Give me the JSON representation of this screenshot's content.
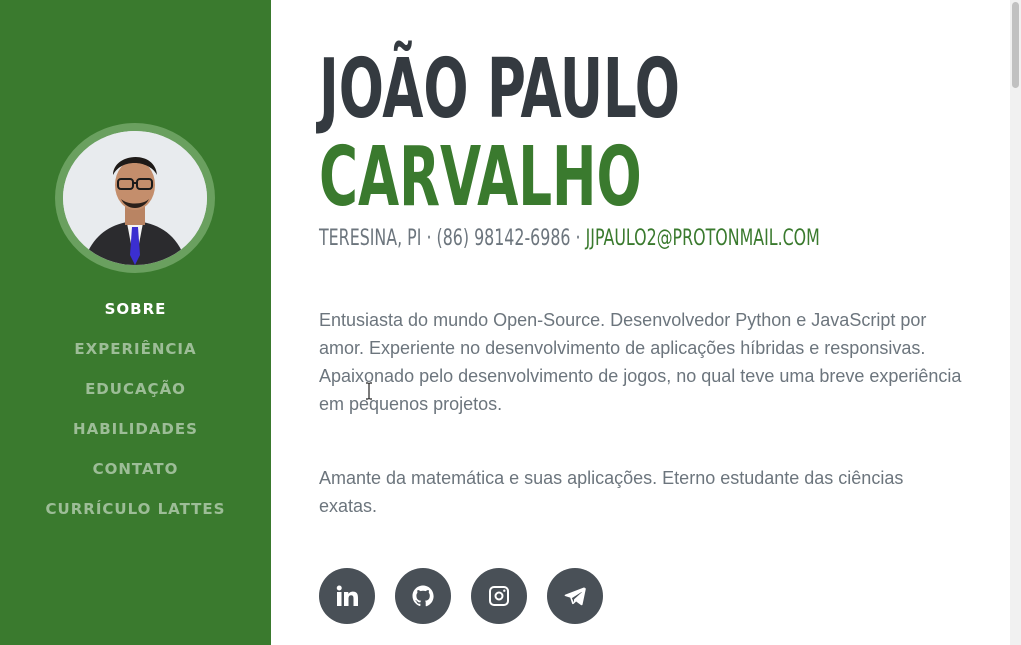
{
  "profile": {
    "first_name": "JOÃO PAULO",
    "last_name": "CARVALHO",
    "location": "TERESINA, PI",
    "phone": "(86) 98142-6986",
    "email": "JJPAULO2@PROTONMAIL.COM",
    "separator": " · "
  },
  "nav": {
    "items": [
      {
        "label": "SOBRE",
        "active": true
      },
      {
        "label": "EXPERIÊNCIA",
        "active": false
      },
      {
        "label": "EDUCAÇÃO",
        "active": false
      },
      {
        "label": "HABILIDADES",
        "active": false
      },
      {
        "label": "CONTATO",
        "active": false
      },
      {
        "label": "CURRÍCULO LATTES",
        "active": false
      }
    ]
  },
  "bio": {
    "paragraph1": "Entusiasta do mundo Open-Source. Desenvolvedor Python e JavaScript por amor. Experiente no desenvolvimento de aplicações híbridas e responsivas. Apaixonado pelo desenvolvimento de jogos, no qual teve uma breve experiência em pequenos projetos.",
    "paragraph2": "Amante da matemática e suas aplicações. Eterno estudante das ciências exatas."
  },
  "socials": [
    {
      "icon": "linkedin-icon"
    },
    {
      "icon": "github-icon"
    },
    {
      "icon": "instagram-icon"
    },
    {
      "icon": "telegram-icon"
    }
  ],
  "colors": {
    "primary": "#3a7a2e",
    "dark": "#343a40",
    "muted": "#6c757d",
    "social_bg": "#495057"
  }
}
